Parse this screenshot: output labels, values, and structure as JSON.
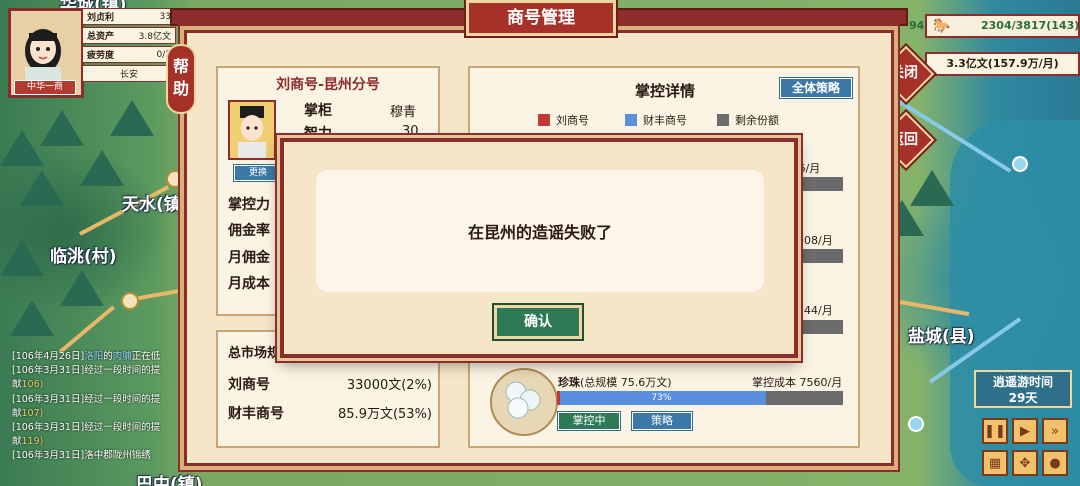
{
  "player": {
    "stats": [
      {
        "key": "刘贞利",
        "value": "33"
      },
      {
        "key": "总资产",
        "value": "3.8亿文"
      },
      {
        "key": "疲劳度",
        "value": "0/3"
      },
      {
        "key": "",
        "value": "长安"
      }
    ],
    "badge": "中华一商"
  },
  "map": {
    "cities": [
      "天水(镇)",
      "临洮(村)",
      "盐城(县)",
      "巴中(镇)"
    ],
    "top_left_city_partial": "华城(镇)"
  },
  "log": {
    "entries": [
      {
        "prefix": "[106年4月26日]",
        "place": "洛阳",
        "mid": "的",
        "item": "肉脯",
        "rest": "正在低"
      },
      {
        "prefix": "[106年3月31日]",
        "place": "",
        "mid": "经过一段时间的提",
        "item": "",
        "rest": ""
      },
      {
        "prefix": "献",
        "place": "",
        "mid": "",
        "item": "",
        "rest": "106)"
      },
      {
        "prefix": "[106年3月31日]",
        "place": "",
        "mid": "经过一段时间的提",
        "item": "",
        "rest": ""
      },
      {
        "prefix": "献",
        "place": "",
        "mid": "",
        "item": "",
        "rest": "107)"
      },
      {
        "prefix": "[106年3月31日]",
        "place": "",
        "mid": "经过一段时间的提",
        "item": "",
        "rest": ""
      },
      {
        "prefix": "献",
        "place": "",
        "mid": "",
        "item": "",
        "rest": "119)"
      },
      {
        "prefix": "[106年3月31日]",
        "place": "",
        "mid": "洛中郡陇州锦绣",
        "item": "",
        "rest": ""
      }
    ]
  },
  "topright": {
    "transport": "2304/3817(143)",
    "transport_prefix": "94",
    "money": "3.3亿文(157.9万/月)",
    "close_label": "关闭",
    "back_label": "返回"
  },
  "dialog": {
    "title": "商号管理",
    "help_label": "帮助",
    "branch": {
      "title": "刘商号-昆州分号",
      "manager_label": "掌柜",
      "manager_value": "穆青",
      "intellect_label": "智力",
      "intellect_value": "30",
      "replace_label": "更换",
      "rows": [
        "掌控力",
        "佣金率",
        "月佣金",
        "月成本"
      ]
    },
    "market": {
      "title": "总市场规",
      "rows": [
        {
          "label": "刘商号",
          "value": "33000文(2%)"
        },
        {
          "label": "财丰商号",
          "value": "85.9万文(53%)"
        }
      ]
    },
    "control": {
      "title": "掌控详情",
      "strategy_all": "全体策略",
      "legend": [
        {
          "name": "刘商号",
          "color": "#c0383a"
        },
        {
          "name": "财丰商号",
          "color": "#5a8fe0"
        },
        {
          "name": "剩余份额",
          "color": "#6b6b6b"
        }
      ],
      "items": [
        {
          "cost_partial": "本 756/月"
        },
        {
          "cost_partial": "2808/月"
        },
        {
          "cost_partial": "4144/月"
        },
        {
          "name": "珍珠",
          "scale": "(总规模 75.6万文)",
          "cost": "掌控成本 7560/月",
          "percent_label": "73%",
          "percent": 0.73,
          "status_label": "掌控中",
          "strategy_label": "策略"
        }
      ]
    }
  },
  "popup": {
    "message": "在昆州的造谣失败了",
    "ok_label": "确认"
  },
  "timebox": {
    "label": "逍遥游时间",
    "days": "29天"
  },
  "controls": [
    "pause-icon",
    "play-icon",
    "fast-forward-icon",
    "crate-icon",
    "footprint-icon",
    "map-pin-icon"
  ]
}
